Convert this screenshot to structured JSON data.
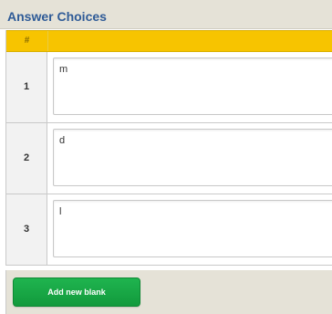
{
  "panel": {
    "title": "Answer Choices"
  },
  "table": {
    "number_header": "#",
    "rows": [
      {
        "number": "1",
        "value": "m"
      },
      {
        "number": "2",
        "value": "d"
      },
      {
        "number": "3",
        "value": "l"
      }
    ]
  },
  "footer": {
    "add_button_label": "Add new blank"
  },
  "colors": {
    "title_text": "#2f5b97",
    "header_bar": "#f7c400",
    "add_button": "#17a746",
    "panel_background": "#e5e2d7"
  }
}
